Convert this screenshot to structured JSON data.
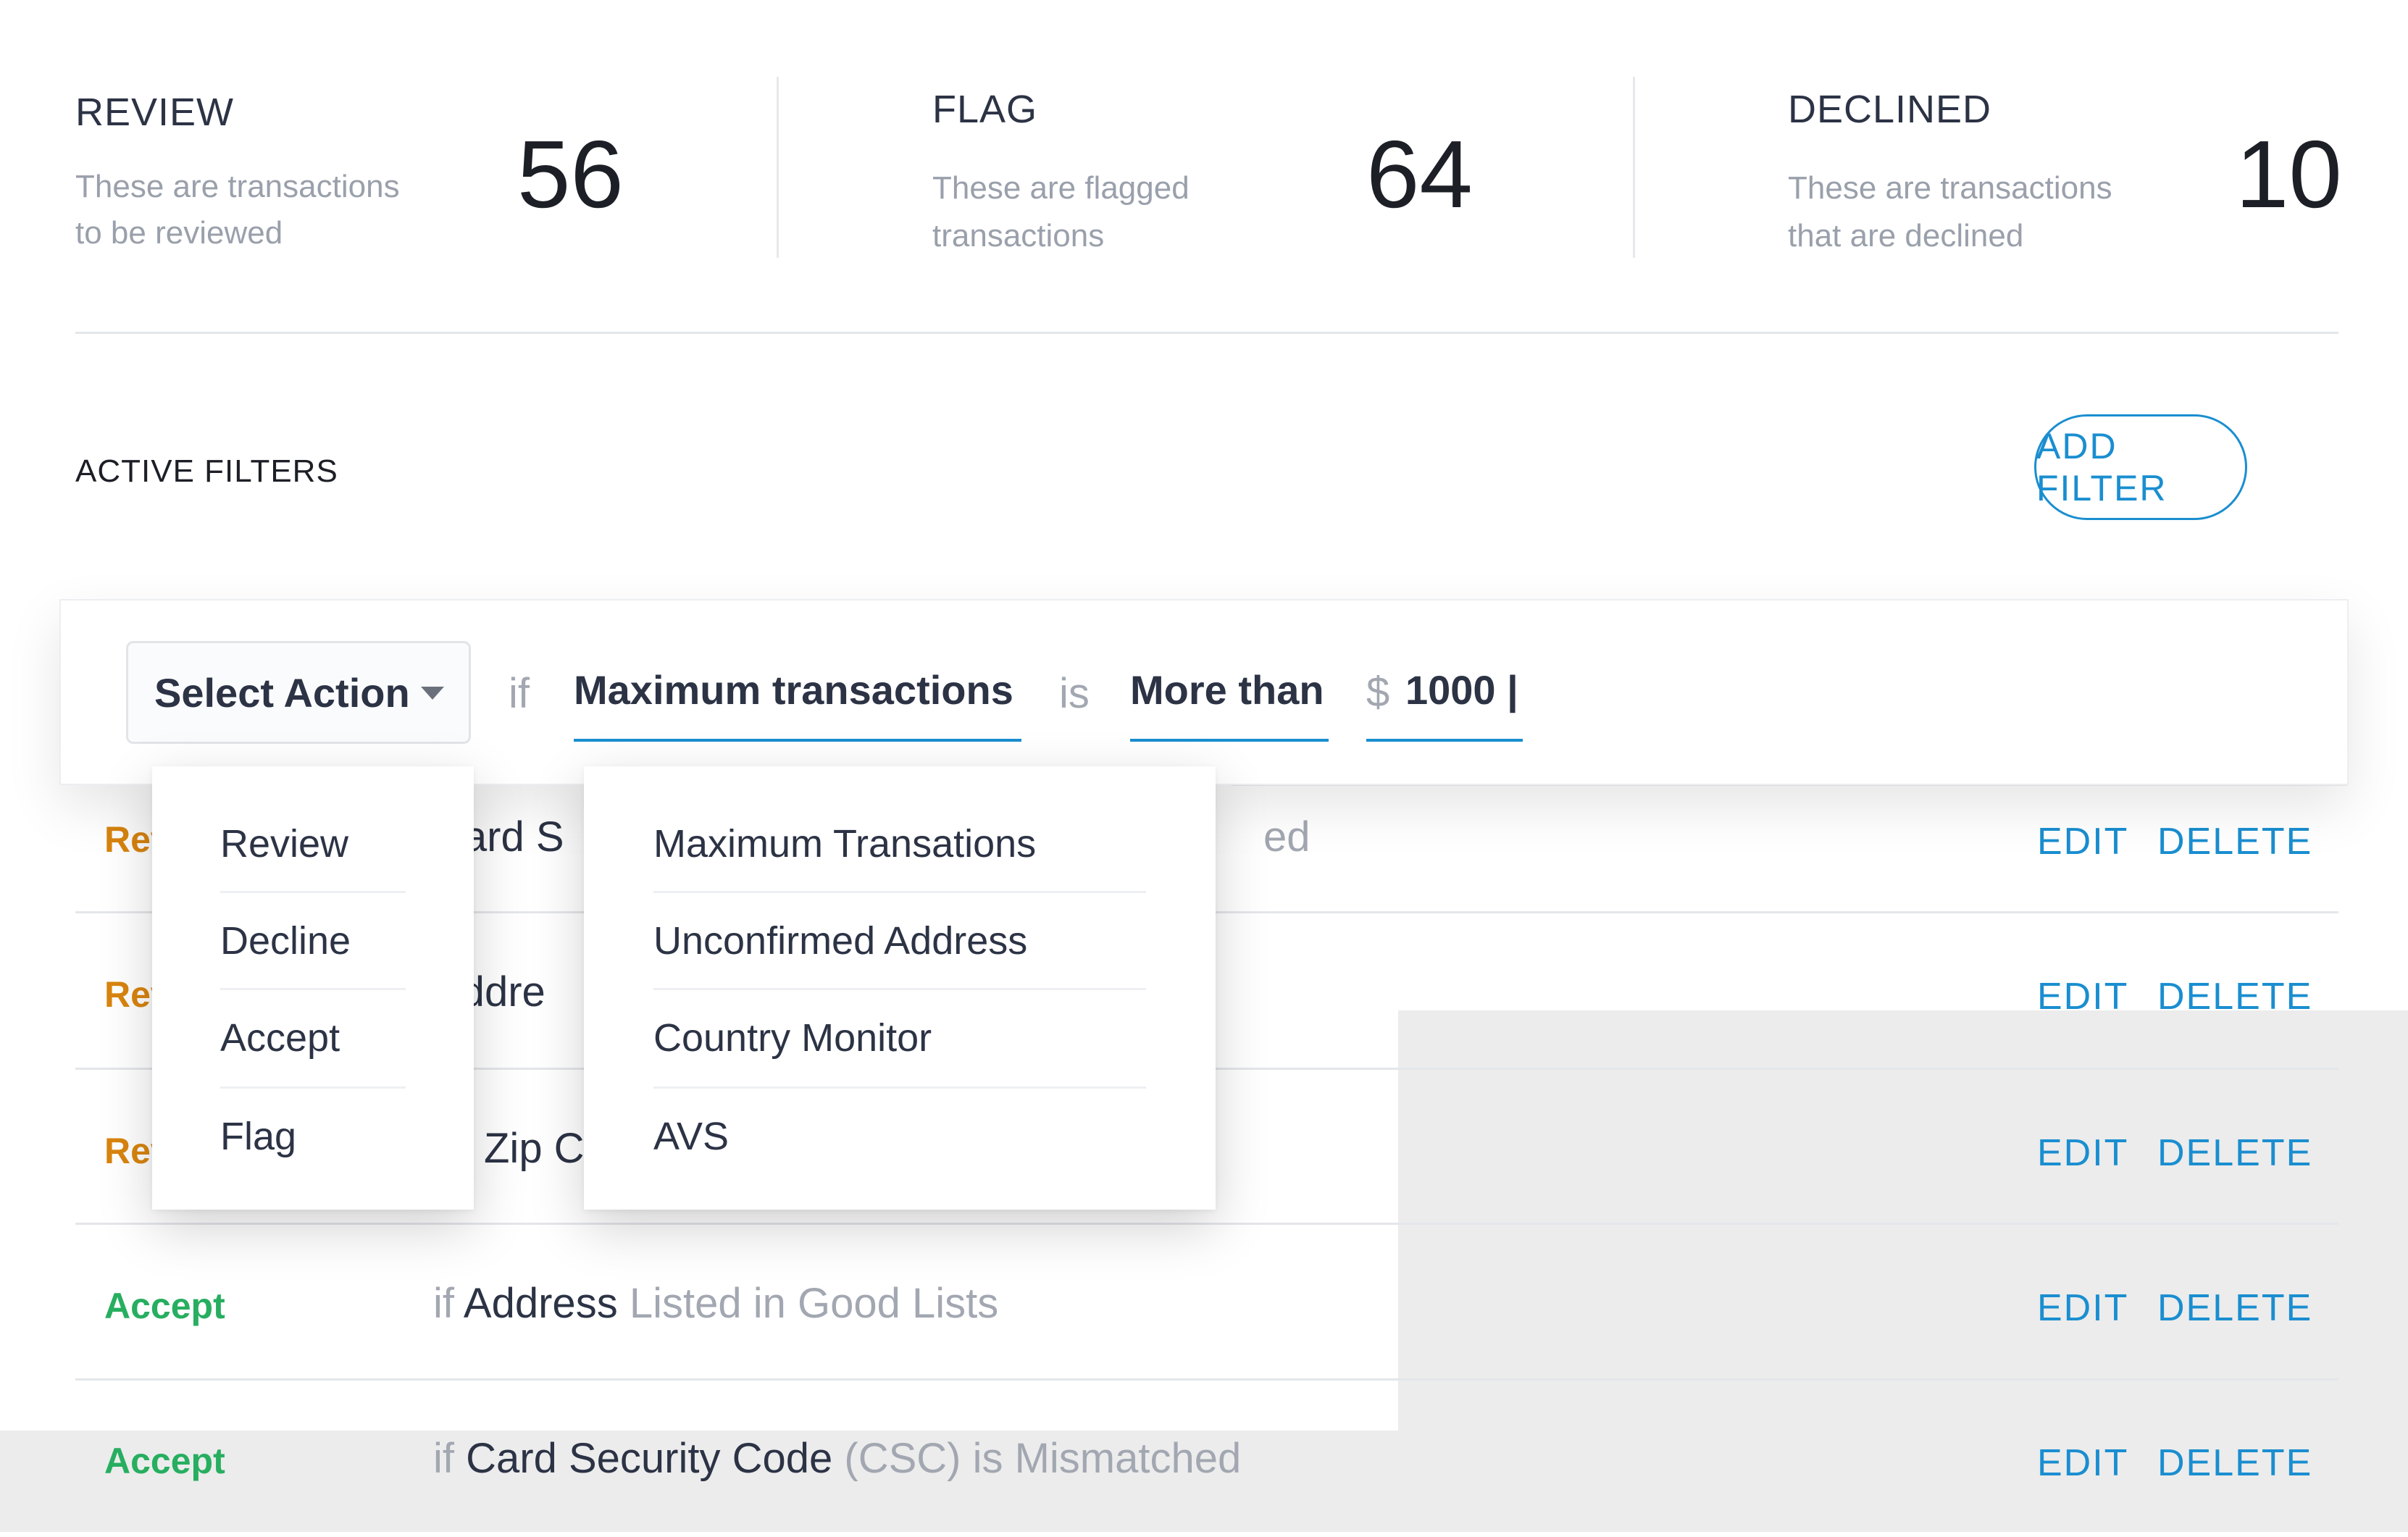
{
  "stats": [
    {
      "title": "REVIEW",
      "desc_line1": "These are transactions",
      "desc_line2": "to be reviewed",
      "count": "56"
    },
    {
      "title": "FLAG",
      "desc_line1": "These are flagged",
      "desc_line2": "transactions",
      "count": "64"
    },
    {
      "title": "DECLINED",
      "desc_line1": "These are transactions",
      "desc_line2": "that are declined",
      "count": "10"
    }
  ],
  "filters_section": {
    "title": "ACTIVE FILTERS",
    "add_button": "ADD FILTER"
  },
  "editor": {
    "select_action": "Select Action",
    "if_kw": "if",
    "field": "Maximum transactions",
    "is_kw": "is",
    "operator": "More than",
    "currency": "$",
    "value": "1000 |"
  },
  "action_options": [
    "Review",
    "Decline",
    "Accept",
    "Flag"
  ],
  "field_options": [
    "Maximum Transations",
    "Unconfirmed Address",
    "Country Monitor",
    "AVS"
  ],
  "rows": [
    {
      "action": "Rev",
      "cond_if": "",
      "cond_field": "Card S",
      "cond_rest": "ed",
      "edit": "EDIT",
      "delete": "DELETE"
    },
    {
      "action": "Rev",
      "cond_if": "",
      "cond_field": "Addre",
      "cond_rest": "",
      "edit": "EDIT",
      "delete": "DELETE"
    },
    {
      "action": "Rev",
      "cond_if": "",
      "cond_field": "Zip C",
      "cond_rest": "",
      "edit": "EDIT",
      "delete": "DELETE"
    },
    {
      "action": "Accept",
      "cond_if": "if",
      "cond_field": "Address",
      "cond_rest": "Listed in Good Lists",
      "edit": "EDIT",
      "delete": "DELETE"
    },
    {
      "action": "Accept",
      "cond_if": "if",
      "cond_field": "Card Security Code",
      "cond_rest": "(CSC) is Mismatched",
      "edit": "EDIT",
      "delete": "DELETE"
    }
  ],
  "colors": {
    "accent": "#1a8ed0",
    "review": "#d9850f",
    "accept": "#27ae60"
  }
}
